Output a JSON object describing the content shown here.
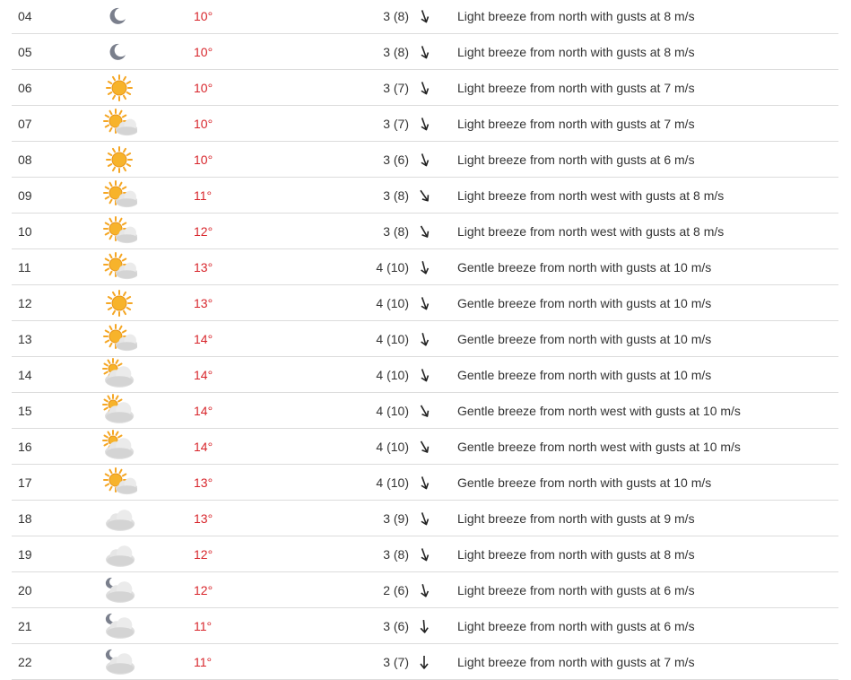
{
  "rows": [
    {
      "hour": "04",
      "icon": "moon-icon",
      "temp": "10°",
      "wind": "3 (8)",
      "arrow_deg": 160,
      "desc": "Light breeze from north with gusts at 8 m/s"
    },
    {
      "hour": "05",
      "icon": "moon-icon",
      "temp": "10°",
      "wind": "3 (8)",
      "arrow_deg": 160,
      "desc": "Light breeze from north with gusts at 8 m/s"
    },
    {
      "hour": "06",
      "icon": "sun-icon",
      "temp": "10°",
      "wind": "3 (7)",
      "arrow_deg": 160,
      "desc": "Light breeze from north with gusts at 7 m/s"
    },
    {
      "hour": "07",
      "icon": "partly-cloudy-icon",
      "temp": "10°",
      "wind": "3 (7)",
      "arrow_deg": 160,
      "desc": "Light breeze from north with gusts at 7 m/s"
    },
    {
      "hour": "08",
      "icon": "sun-icon",
      "temp": "10°",
      "wind": "3 (6)",
      "arrow_deg": 160,
      "desc": "Light breeze from north with gusts at 6 m/s"
    },
    {
      "hour": "09",
      "icon": "partly-cloudy-icon",
      "temp": "11°",
      "wind": "3 (8)",
      "arrow_deg": 145,
      "desc": "Light breeze from north west with gusts at 8 m/s"
    },
    {
      "hour": "10",
      "icon": "partly-cloudy-icon",
      "temp": "12°",
      "wind": "3 (8)",
      "arrow_deg": 150,
      "desc": "Light breeze from north west with gusts at 8 m/s"
    },
    {
      "hour": "11",
      "icon": "partly-cloudy-icon",
      "temp": "13°",
      "wind": "4 (10)",
      "arrow_deg": 165,
      "desc": "Gentle breeze from north with gusts at 10 m/s"
    },
    {
      "hour": "12",
      "icon": "sun-icon",
      "temp": "13°",
      "wind": "4 (10)",
      "arrow_deg": 160,
      "desc": "Gentle breeze from north with gusts at 10 m/s"
    },
    {
      "hour": "13",
      "icon": "partly-cloudy-icon",
      "temp": "14°",
      "wind": "4 (10)",
      "arrow_deg": 165,
      "desc": "Gentle breeze from north with gusts at 10 m/s"
    },
    {
      "hour": "14",
      "icon": "cloudy-sun-icon",
      "temp": "14°",
      "wind": "4 (10)",
      "arrow_deg": 160,
      "desc": "Gentle breeze from north with gusts at 10 m/s"
    },
    {
      "hour": "15",
      "icon": "cloudy-sun-icon",
      "temp": "14°",
      "wind": "4 (10)",
      "arrow_deg": 150,
      "desc": "Gentle breeze from north west with gusts at 10 m/s"
    },
    {
      "hour": "16",
      "icon": "cloudy-sun-icon",
      "temp": "14°",
      "wind": "4 (10)",
      "arrow_deg": 150,
      "desc": "Gentle breeze from north west with gusts at 10 m/s"
    },
    {
      "hour": "17",
      "icon": "partly-cloudy-icon",
      "temp": "13°",
      "wind": "4 (10)",
      "arrow_deg": 160,
      "desc": "Gentle breeze from north with gusts at 10 m/s"
    },
    {
      "hour": "18",
      "icon": "cloud-icon",
      "temp": "13°",
      "wind": "3 (9)",
      "arrow_deg": 160,
      "desc": "Light breeze from north with gusts at 9 m/s"
    },
    {
      "hour": "19",
      "icon": "cloud-icon",
      "temp": "12°",
      "wind": "3 (8)",
      "arrow_deg": 160,
      "desc": "Light breeze from north with gusts at 8 m/s"
    },
    {
      "hour": "20",
      "icon": "cloudy-moon-icon",
      "temp": "12°",
      "wind": "2 (6)",
      "arrow_deg": 165,
      "desc": "Light breeze from north with gusts at 6 m/s"
    },
    {
      "hour": "21",
      "icon": "cloudy-moon-icon",
      "temp": "11°",
      "wind": "3 (6)",
      "arrow_deg": 175,
      "desc": "Light breeze from north with gusts at 6 m/s"
    },
    {
      "hour": "22",
      "icon": "cloudy-moon-icon",
      "temp": "11°",
      "wind": "3 (7)",
      "arrow_deg": 180,
      "desc": "Light breeze from north with gusts at 7 m/s"
    }
  ],
  "colors": {
    "temp": "#d8262c",
    "text": "#333333",
    "divider": "#dcdcdc",
    "sun": "#f5a623",
    "cloud": "#d8d8d8",
    "moon": "#7a7f8c"
  }
}
